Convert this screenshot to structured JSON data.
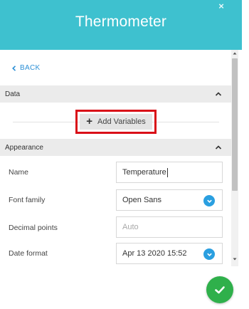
{
  "header": {
    "title": "Thermometer",
    "close_symbol": "×"
  },
  "nav": {
    "back_label": "BACK"
  },
  "data_section": {
    "title": "Data",
    "add_button_label": "Add Variables",
    "add_symbol": "+"
  },
  "appearance_section": {
    "title": "Appearance",
    "fields": {
      "name": {
        "label": "Name",
        "value": "Temperature"
      },
      "font_family": {
        "label": "Font family",
        "value": "Open Sans"
      },
      "decimal_points": {
        "label": "Decimal points",
        "placeholder": "Auto"
      },
      "date_format": {
        "label": "Date format",
        "value": "Apr 13 2020 15:52"
      }
    }
  },
  "colors": {
    "header": "#3ec1cf",
    "accent": "#2a9fe0",
    "confirm": "#2fb04b",
    "highlight": "#d90f18"
  },
  "icons": {
    "back": "chevron-left-icon",
    "collapse": "chevron-up-icon",
    "dropdown": "chevron-down-icon",
    "confirm": "check-icon"
  }
}
